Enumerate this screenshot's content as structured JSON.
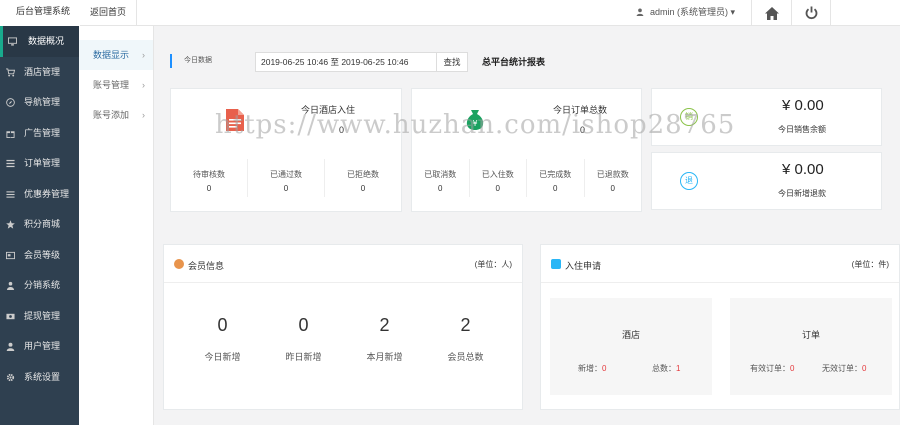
{
  "topbar": {
    "brand": "后台管理系统",
    "back_home": "返回首页",
    "user": "admin (系统管理员)",
    "user_caret": "▾"
  },
  "sidebar": {
    "items": [
      {
        "label": "数据概况",
        "icon": "monitor-icon"
      },
      {
        "label": "酒店管理",
        "icon": "cart-icon"
      },
      {
        "label": "导航管理",
        "icon": "compass-icon"
      },
      {
        "label": "广告管理",
        "icon": "gift-icon"
      },
      {
        "label": "订单管理",
        "icon": "list-icon"
      },
      {
        "label": "优惠券管理",
        "icon": "menu-icon"
      },
      {
        "label": "积分商城",
        "icon": "star-icon"
      },
      {
        "label": "会员等级",
        "icon": "card-icon"
      },
      {
        "label": "分销系统",
        "icon": "share-icon"
      },
      {
        "label": "提现管理",
        "icon": "cash-icon"
      },
      {
        "label": "用户管理",
        "icon": "user-icon"
      },
      {
        "label": "系统设置",
        "icon": "gear-icon"
      }
    ]
  },
  "subnav": {
    "items": [
      {
        "label": "数据显示",
        "chev": "›"
      },
      {
        "label": "账号管理",
        "chev": "›"
      },
      {
        "label": "账号添加",
        "chev": "›"
      }
    ]
  },
  "filter": {
    "label": "今日数据",
    "date_range": "2019-06-25 10:46 至 2019-06-25 10:46",
    "query": "查找",
    "report_title": "总平台统计报表"
  },
  "hotel_card": {
    "title": "今日酒店入住",
    "value": "0",
    "subs": [
      {
        "label": "待审核数",
        "value": "0"
      },
      {
        "label": "已通过数",
        "value": "0"
      },
      {
        "label": "已拒绝数",
        "value": "0"
      }
    ]
  },
  "order_card": {
    "title": "今日订单总数",
    "value": "0",
    "subs": [
      {
        "label": "已取消数",
        "value": "0"
      },
      {
        "label": "已入住数",
        "value": "0"
      },
      {
        "label": "已完成数",
        "value": "0"
      },
      {
        "label": "已退款数",
        "value": "0"
      }
    ]
  },
  "money_card": {
    "icon_text": "销",
    "value": "¥ 0.00",
    "label": "今日销售余额"
  },
  "refund_card": {
    "icon_text": "退",
    "value": "¥ 0.00",
    "label": "今日新增退款"
  },
  "member_panel": {
    "title": "会员信息",
    "unit": "(单位：人)",
    "metrics": [
      {
        "value": "0",
        "label": "今日新增"
      },
      {
        "value": "0",
        "label": "昨日新增"
      },
      {
        "value": "2",
        "label": "本月新增"
      },
      {
        "value": "2",
        "label": "会员总数"
      }
    ]
  },
  "apply_panel": {
    "title": "入住申请",
    "unit": "(单位：件)",
    "hotel": {
      "title": "酒店",
      "l1": "新增：",
      "v1": "0",
      "l2": "总数：",
      "v2": "1"
    },
    "order": {
      "title": "订单",
      "l1": "有效订单：",
      "v1": "0",
      "l2": "无效订单：",
      "v2": "0"
    }
  },
  "watermark": "https://www.huzhan.com/ishop28765",
  "colors": {
    "sidebar_bg": "#2f4050",
    "accent": "#19aa8d",
    "red": "#e4393c",
    "hotel_icon": "#e8604c",
    "order_icon": "#1aa260"
  }
}
